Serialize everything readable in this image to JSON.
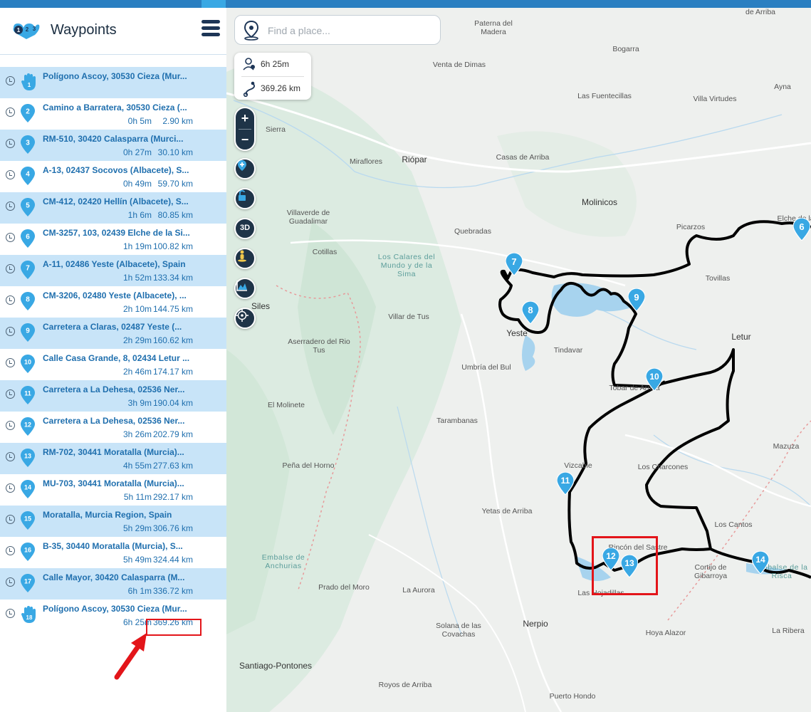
{
  "app": {
    "title": "Waypoints"
  },
  "search": {
    "placeholder": "Find a place..."
  },
  "summary": {
    "time": "6h 25m",
    "distance": "369.26 km"
  },
  "colors": {
    "accent": "#39a8e4",
    "route": "#000000",
    "highlight": "#e3151a",
    "row_shade": "#c8e4f8"
  },
  "controls": {
    "zoom_in": "+",
    "zoom_out": "−",
    "three_d": "3D"
  },
  "waypoints": [
    {
      "n": "1",
      "addr": "Polígono Ascoy, 30530 Cieza (Mur...",
      "time": "",
      "dist": "",
      "icon": "hand-start-icon"
    },
    {
      "n": "2",
      "addr": "Camino a Barratera, 30530 Cieza (...",
      "time": "0h 5m",
      "dist": "2.90 km",
      "icon": "marker-icon"
    },
    {
      "n": "3",
      "addr": "RM-510, 30420 Calasparra (Murci...",
      "time": "0h 27m",
      "dist": "30.10 km",
      "icon": "marker-icon"
    },
    {
      "n": "4",
      "addr": "A-13, 02437 Socovos (Albacete), S...",
      "time": "0h 49m",
      "dist": "59.70 km",
      "icon": "marker-icon"
    },
    {
      "n": "5",
      "addr": "CM-412, 02420 Hellín (Albacete), S...",
      "time": "1h 6m",
      "dist": "80.85 km",
      "icon": "marker-icon"
    },
    {
      "n": "6",
      "addr": "CM-3257, 103, 02439 Elche de la Si...",
      "time": "1h 19m",
      "dist": "100.82 km",
      "icon": "marker-icon"
    },
    {
      "n": "7",
      "addr": "A-11, 02486 Yeste (Albacete), Spain",
      "time": "1h 52m",
      "dist": "133.34 km",
      "icon": "marker-icon"
    },
    {
      "n": "8",
      "addr": "CM-3206, 02480 Yeste (Albacete), ...",
      "time": "2h 10m",
      "dist": "144.75 km",
      "icon": "marker-icon"
    },
    {
      "n": "9",
      "addr": "Carretera a Claras, 02487 Yeste (...",
      "time": "2h 29m",
      "dist": "160.62 km",
      "icon": "marker-icon"
    },
    {
      "n": "10",
      "addr": "Calle Casa Grande, 8, 02434 Letur ...",
      "time": "2h 46m",
      "dist": "174.17 km",
      "icon": "marker-icon"
    },
    {
      "n": "11",
      "addr": "Carretera a La Dehesa, 02536 Ner...",
      "time": "3h 9m",
      "dist": "190.04 km",
      "icon": "marker-icon"
    },
    {
      "n": "12",
      "addr": "Carretera a La Dehesa, 02536 Ner...",
      "time": "3h 26m",
      "dist": "202.79 km",
      "icon": "marker-icon"
    },
    {
      "n": "13",
      "addr": "RM-702, 30441 Moratalla (Murcia)...",
      "time": "4h 55m",
      "dist": "277.63 km",
      "icon": "marker-icon"
    },
    {
      "n": "14",
      "addr": "MU-703, 30441 Moratalla (Murcia)...",
      "time": "5h 11m",
      "dist": "292.17 km",
      "icon": "marker-icon"
    },
    {
      "n": "15",
      "addr": "Moratalla, Murcia Region, Spain",
      "time": "5h 29m",
      "dist": "306.76 km",
      "icon": "marker-icon"
    },
    {
      "n": "16",
      "addr": "B-35, 30440 Moratalla (Murcia), S...",
      "time": "5h 49m",
      "dist": "324.44 km",
      "icon": "marker-icon"
    },
    {
      "n": "17",
      "addr": "Calle Mayor, 30420 Calasparra (M...",
      "time": "6h 1m",
      "dist": "336.72 km",
      "icon": "marker-icon"
    },
    {
      "n": "18",
      "addr": "Polígono Ascoy, 30530 Cieza (Mur...",
      "time": "6h 25m",
      "dist": "369.26 km",
      "icon": "hand-end-icon"
    }
  ],
  "map_labels": [
    "de Arriba",
    "Paterna del Madera",
    "Bogarra",
    "Ayna",
    "Venta de Dimas",
    "Las Fuentecillas",
    "Villa Virtudes",
    "Sierra",
    "Riópar",
    "Miraflores",
    "Casas de Arriba",
    "Molinicos",
    "Villaverde de Guadalimar",
    "Quebradas",
    "Picarzos",
    "Cotillas",
    "Los Calares del Mundo y de la Sima",
    "Tovillas",
    "Yeste",
    "Siles",
    "Villar de Tus",
    "Tindavar",
    "Letur",
    "Aserradero del Rio Tus",
    "Umbría del Bul",
    "Tobar de Arriba",
    "El Molinete",
    "Tarambanas",
    "Mazuza",
    "Vizcable",
    "Los Charcones",
    "Peña del Horno",
    "Yetas de Arriba",
    "Los Cantos",
    "Embalse de Anchurias",
    "Rincón del Sastre",
    "Prado del Moro",
    "La Aurora",
    "Las Hojadillas",
    "Cortijo de Gibarroya",
    "Nerpio",
    "Solana de las Covachas",
    "Hoya Alazor",
    "La Ribera",
    "Santiago-Pontones",
    "Royos de Arriba",
    "Puerto Hondo",
    "Elche de la Sierra",
    "Embalse de la Risca"
  ]
}
